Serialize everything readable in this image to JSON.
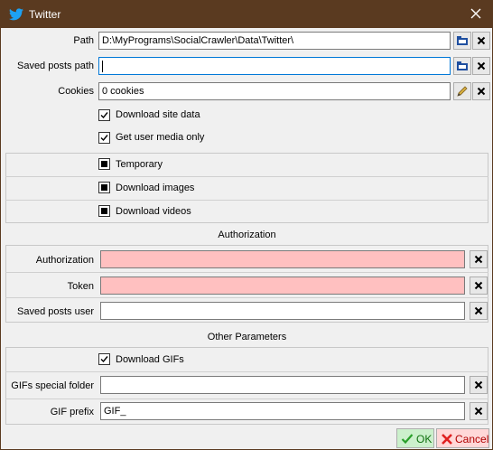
{
  "window": {
    "title": "Twitter"
  },
  "fields": {
    "path": {
      "label": "Path",
      "value": "D:\\MyPrograms\\SocialCrawler\\Data\\Twitter\\"
    },
    "saved_posts_path": {
      "label": "Saved posts path",
      "value": ""
    },
    "cookies": {
      "label": "Cookies",
      "value": "0 cookies"
    },
    "authorization": {
      "label": "Authorization",
      "value": ""
    },
    "token": {
      "label": "Token",
      "value": ""
    },
    "saved_posts_user": {
      "label": "Saved posts user",
      "value": ""
    },
    "gifs_special_folder": {
      "label": "GIFs special folder",
      "value": ""
    },
    "gif_prefix": {
      "label": "GIF prefix",
      "value": "GIF_"
    }
  },
  "checkboxes": {
    "download_site_data": {
      "label": "Download site data",
      "checked": true
    },
    "get_user_media_only": {
      "label": "Get user media only",
      "checked": true
    },
    "temporary": {
      "label": "Temporary",
      "state": "indeterminate"
    },
    "download_images": {
      "label": "Download images",
      "state": "indeterminate"
    },
    "download_videos": {
      "label": "Download videos",
      "state": "indeterminate"
    },
    "download_gifs": {
      "label": "Download GIFs",
      "checked": true
    }
  },
  "sections": {
    "authorization": "Authorization",
    "other_parameters": "Other Parameters"
  },
  "footer": {
    "ok": "OK",
    "cancel": "Cancel"
  },
  "colors": {
    "titlebar": "#5a3a20",
    "pink_field": "#ffc0c0",
    "twitter_blue": "#1da1f2"
  }
}
